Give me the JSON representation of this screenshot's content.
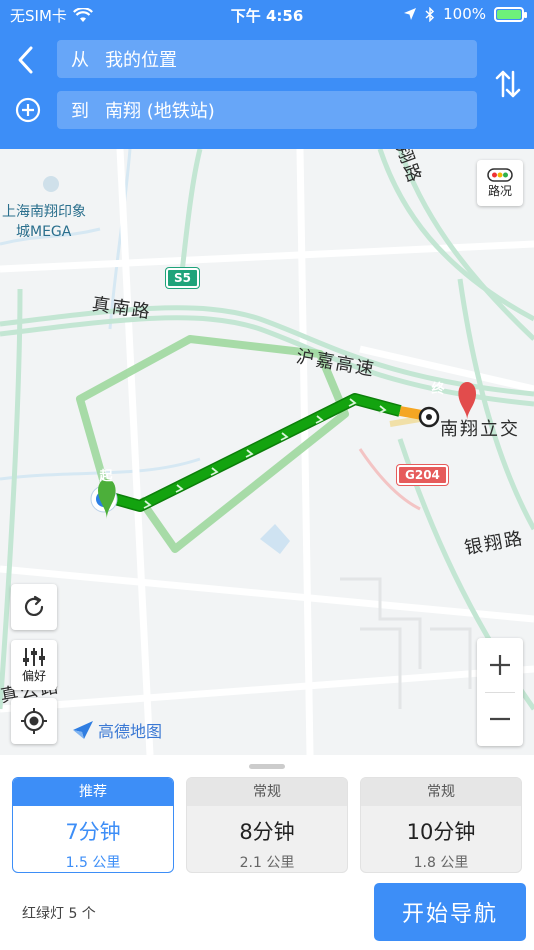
{
  "status_bar": {
    "carrier": "无SIM卡",
    "time": "下午 4:56",
    "battery": "100%",
    "battery_level": 1.0
  },
  "header": {
    "from_prefix": "从",
    "from_value": "我的位置",
    "to_prefix": "到",
    "to_value": "南翔 (地铁站)"
  },
  "map": {
    "labels": {
      "poi_line1": "上海南翔印象",
      "poi_line2": "城MEGA",
      "road_zhennan": "真南路",
      "road_hujia": "沪嘉高速",
      "road_yinxiang": "银翔路",
      "dest_name": "南翔立交",
      "road_top": "翔路",
      "road_bottom_left": "真公路",
      "badge_s5": "S5",
      "badge_g204": "G204"
    },
    "start_marker": "起",
    "end_marker": "终",
    "buttons": {
      "traffic": "路况",
      "preference": "偏好"
    },
    "logo_text": "高德地图",
    "colors": {
      "route_main": "#13a30f",
      "route_alt": "#9ed89f",
      "header_blue": "#3d8ef7"
    }
  },
  "routes": [
    {
      "tag": "推荐",
      "time": "7分钟",
      "distance": "1.5 公里",
      "selected": true
    },
    {
      "tag": "常规",
      "time": "8分钟",
      "distance": "2.1 公里",
      "selected": false
    },
    {
      "tag": "常规",
      "time": "10分钟",
      "distance": "1.8 公里",
      "selected": false
    }
  ],
  "footer": {
    "traffic_lights": "红绿灯 5 个",
    "start_button": "开始导航"
  }
}
